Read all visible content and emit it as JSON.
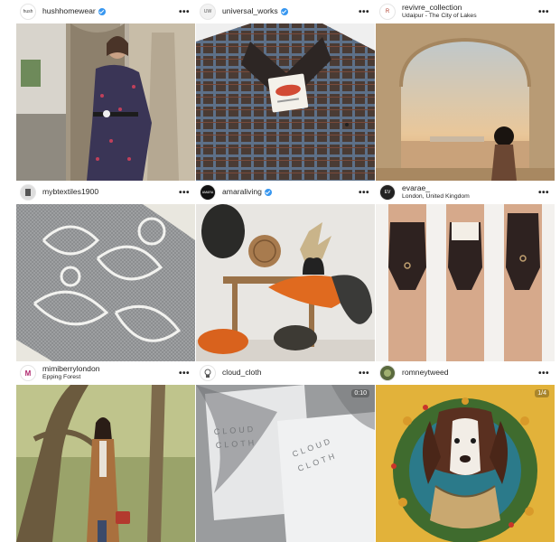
{
  "posts": [
    {
      "username": "hushhomewear",
      "verified": true,
      "location": "",
      "avatar_text": "hush",
      "image": "woman-floral-dress-stone-archway"
    },
    {
      "username": "universal_works",
      "verified": true,
      "location": "",
      "avatar_text": "UW",
      "image": "plaid-wool-jacket-label"
    },
    {
      "username": "revivre_collection",
      "verified": false,
      "location": "Udaipur - The City of Lakes",
      "avatar_text": "R",
      "image": "palace-arch-lake-sunset"
    },
    {
      "username": "mybtextiles1900",
      "verified": false,
      "location": "",
      "avatar_text": "",
      "image": "white-lace-rose-pattern"
    },
    {
      "username": "amaraliving",
      "verified": true,
      "location": "",
      "avatar_text": "AMARA",
      "image": "faux-fur-cushions-wooden-stools"
    },
    {
      "username": "evarae_",
      "verified": false,
      "location": "London, United Kingdom",
      "avatar_text": "EV",
      "image": "three-models-black-swimsuits"
    },
    {
      "username": "mimiberrylondon",
      "verified": false,
      "location": "Epping Forest",
      "avatar_text": "M",
      "image": "woman-camel-coat-forest"
    },
    {
      "username": "cloud_cloth",
      "verified": false,
      "location": "",
      "avatar_text": "",
      "image": "cloud-cloth-packaging",
      "badge": "0:10"
    },
    {
      "username": "romneytweed",
      "verified": false,
      "location": "",
      "avatar_text": "",
      "image": "spaniel-christmas-wreath",
      "badge": "1/4"
    }
  ],
  "more_glyph": "•••"
}
